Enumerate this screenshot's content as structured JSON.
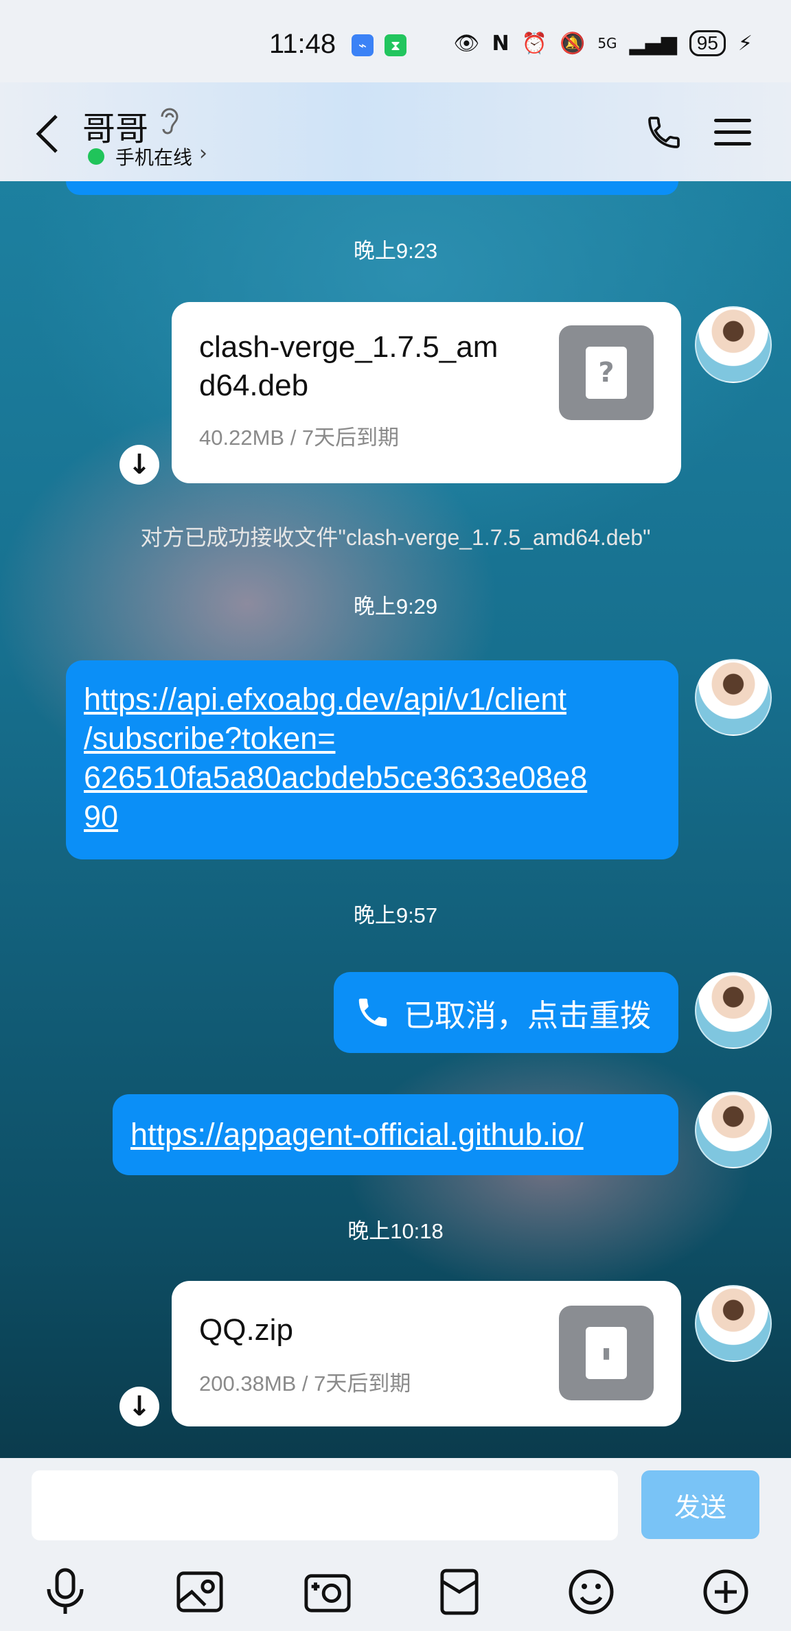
{
  "status_bar": {
    "time": "11:48",
    "battery": "95",
    "network": "5G",
    "accent_colors": {
      "usb": "#3b82f6",
      "timer": "#22c55e"
    }
  },
  "header": {
    "contact_name": "哥哥",
    "online_status": "手机在线",
    "icons": [
      "back-arrow-icon",
      "ear-icon",
      "phone-icon",
      "menu-icon"
    ]
  },
  "messages": {
    "time_1": "晚上9:23",
    "file_1": {
      "name_line1": "clash-verge_1.7.5_am",
      "name_line2": "d64.deb",
      "meta": "40.22MB / 7天后到期",
      "icon": "unknown-file-icon"
    },
    "notice_1": "对方已成功接收文件\"clash-verge_1.7.5_amd64.deb\"",
    "time_2": "晚上9:29",
    "link_1_lines": [
      "https://api.efxoabg.dev/api/v1/client",
      "/subscribe?token=",
      "626510fa5a80acbdeb5ce3633e08e8",
      "90"
    ],
    "time_3": "晚上9:57",
    "call": {
      "text": "已取消，点击重拨",
      "icon": "phone-icon"
    },
    "link_2": "https://appagent-official.github.io/",
    "time_4": "晚上10:18",
    "file_2": {
      "name": "QQ.zip",
      "meta": "200.38MB / 7天后到期",
      "icon": "zip-file-icon"
    }
  },
  "input_bar": {
    "placeholder": "",
    "send_label": "发送",
    "tools": [
      "microphone-icon",
      "image-icon",
      "camera-icon",
      "red-packet-icon",
      "emoji-icon",
      "plus-icon"
    ]
  },
  "colors": {
    "bubble_blue": "#0b8ff7",
    "send_disabled": "#79c3f6",
    "online_green": "#20c45a"
  }
}
